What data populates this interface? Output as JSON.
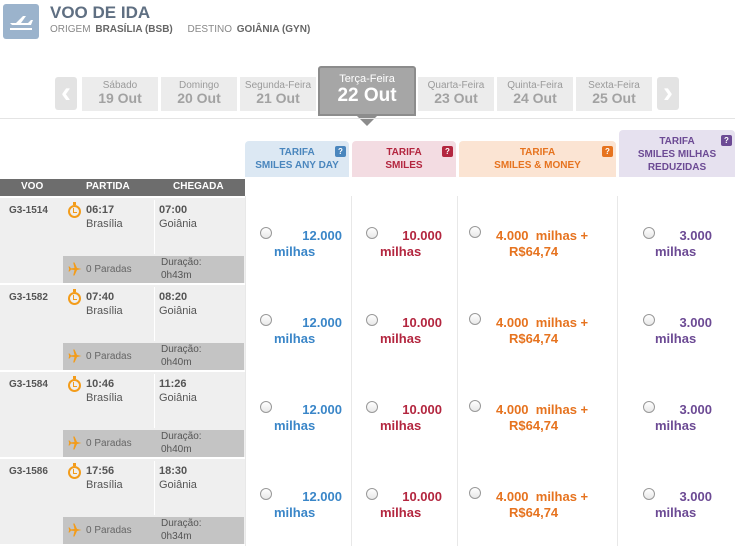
{
  "header": {
    "title": "VOO DE IDA",
    "origin_label": "ORIGEM",
    "origin_value": "BRASÍLIA (BSB)",
    "dest_label": "DESTINO",
    "dest_value": "GOIÂNIA (GYN)"
  },
  "dates": [
    {
      "weekday": "Sábado",
      "date": "19 Out"
    },
    {
      "weekday": "Domingo",
      "date": "20 Out"
    },
    {
      "weekday": "Segunda-Feira",
      "date": "21 Out"
    },
    {
      "weekday": "Terça-Feira",
      "date": "22 Out",
      "selected": true
    },
    {
      "weekday": "Quarta-Feira",
      "date": "23 Out"
    },
    {
      "weekday": "Quinta-Feira",
      "date": "24 Out"
    },
    {
      "weekday": "Sexta-Feira",
      "date": "25 Out"
    }
  ],
  "fares": {
    "any": {
      "line1": "TARIFA",
      "line2": "SMILES ANY DAY",
      "help": "?"
    },
    "smiles": {
      "line1": "TARIFA",
      "line2": "SMILES",
      "help": "?"
    },
    "money": {
      "line1": "TARIFA",
      "line2": "SMILES & MONEY",
      "help": "?"
    },
    "reduced": {
      "line1": "TARIFA",
      "line2": "SMILES MILHAS",
      "line3": "REDUZIDAS",
      "help": "?"
    }
  },
  "columns": {
    "voo": "VOO",
    "partida": "PARTIDA",
    "chegada": "CHEGADA"
  },
  "flights": [
    {
      "number": "G3-1514",
      "dep_time": "06:17",
      "dep_city": "Brasília",
      "arr_time": "07:00",
      "arr_city": "Goiânia",
      "stops": "0 Paradas",
      "dur_label": "Duração:",
      "dur": "0h43m",
      "any1": "12.000",
      "any2": "milhas",
      "smi1": "10.000",
      "smi2": "milhas",
      "mon1": "4.000  milhas +",
      "mon2": "R$64,74",
      "red1": "3.000",
      "red2": "milhas"
    },
    {
      "number": "G3-1582",
      "dep_time": "07:40",
      "dep_city": "Brasília",
      "arr_time": "08:20",
      "arr_city": "Goiânia",
      "stops": "0 Paradas",
      "dur_label": "Duração:",
      "dur": "0h40m",
      "any1": "12.000",
      "any2": "milhas",
      "smi1": "10.000",
      "smi2": "milhas",
      "mon1": "4.000  milhas +",
      "mon2": "R$64,74",
      "red1": "3.000",
      "red2": "milhas"
    },
    {
      "number": "G3-1584",
      "dep_time": "10:46",
      "dep_city": "Brasília",
      "arr_time": "11:26",
      "arr_city": "Goiânia",
      "stops": "0 Paradas",
      "dur_label": "Duração:",
      "dur": "0h40m",
      "any1": "12.000",
      "any2": "milhas",
      "smi1": "10.000",
      "smi2": "milhas",
      "mon1": "4.000  milhas +",
      "mon2": "R$64,74",
      "red1": "3.000",
      "red2": "milhas"
    },
    {
      "number": "G3-1586",
      "dep_time": "17:56",
      "dep_city": "Brasília",
      "arr_time": "18:30",
      "arr_city": "Goiânia",
      "stops": "0 Paradas",
      "dur_label": "Duração:",
      "dur": "0h34m",
      "any1": "12.000",
      "any2": "milhas",
      "smi1": "10.000",
      "smi2": "milhas",
      "mon1": "4.000  milhas +",
      "mon2": "R$64,74",
      "red1": "3.000",
      "red2": "milhas"
    }
  ],
  "colors": {
    "any": "#3a86c8",
    "smiles": "#b3263f",
    "money": "#e6731f",
    "reduced": "#6c4a94"
  }
}
